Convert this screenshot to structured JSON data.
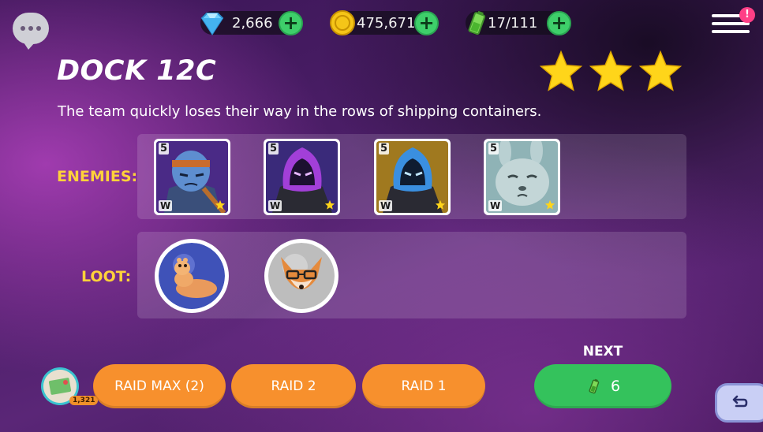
{
  "currencies": {
    "gems": "2,666",
    "coins": "475,671",
    "energy": "17/111"
  },
  "menu": {
    "notification_badge": "!"
  },
  "mission": {
    "title": "DOCK 12C",
    "stars_earned": 3,
    "description": "The team quickly loses their way in the rows of shipping containers."
  },
  "enemies": {
    "label": "ENEMIES:",
    "items": [
      {
        "level": "5",
        "class": "W",
        "name": "masked-brawler"
      },
      {
        "level": "5",
        "class": "W",
        "name": "purple-hooded-shadow"
      },
      {
        "level": "5",
        "class": "W",
        "name": "blue-hooded-shadow"
      },
      {
        "level": "5",
        "class": "W",
        "name": "grumpy-bunny"
      }
    ]
  },
  "loot": {
    "label": "LOOT:",
    "items": [
      {
        "name": "worm-creature-orb"
      },
      {
        "name": "fox-with-glasses-orb"
      }
    ]
  },
  "footer": {
    "avatar_count": "1,321",
    "raid_max_label": "RAID MAX (2)",
    "raid_2_label": "RAID 2",
    "raid_1_label": "RAID 1",
    "next_label": "NEXT",
    "next_cost": "6"
  },
  "colors": {
    "accent_orange": "#f7902d",
    "accent_green": "#34c25c",
    "label_yellow": "#ffd23a",
    "star_yellow": "#ffd51a"
  }
}
